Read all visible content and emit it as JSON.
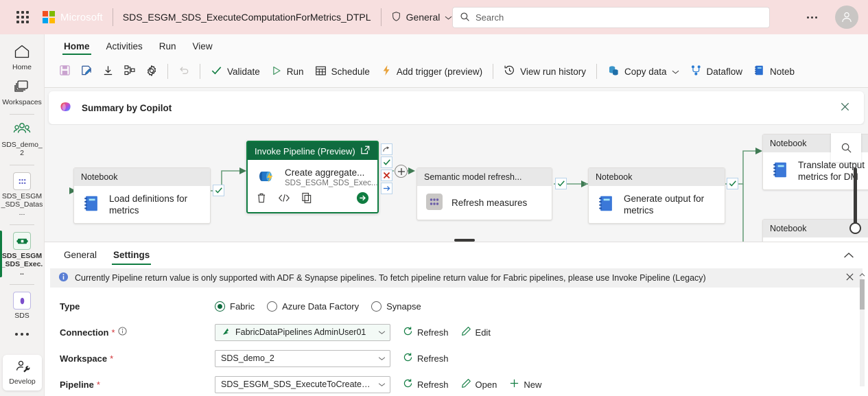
{
  "topbar": {
    "brand": "Microsoft",
    "doc_title": "SDS_ESGM_SDS_ExecuteComputationForMetrics_DTPL",
    "workspace_badge": "General",
    "search_placeholder": "Search",
    "search_value": ""
  },
  "rail": {
    "items": [
      {
        "label": "Home",
        "icon": "home-icon"
      },
      {
        "label": "Workspaces",
        "icon": "workspaces-icon"
      },
      {
        "label": "SDS_demo_2",
        "icon": "people-icon"
      },
      {
        "label": "SDS_ESGM_SDS_Datas...",
        "icon": "lakehouse-icon"
      },
      {
        "label": "SDS_ESGM_SDS_Exec...",
        "icon": "pipeline-icon"
      },
      {
        "label": "SDS",
        "icon": "semantic-model-icon"
      }
    ],
    "more": "...",
    "develop": "Develop"
  },
  "ribbon": {
    "tabs": [
      {
        "label": "Home",
        "active": true
      },
      {
        "label": "Activities",
        "active": false
      },
      {
        "label": "Run",
        "active": false
      },
      {
        "label": "View",
        "active": false
      }
    ],
    "toolbar": [
      {
        "label": "",
        "icon": "save-icon"
      },
      {
        "label": "",
        "icon": "save-as-icon"
      },
      {
        "label": "",
        "icon": "download-icon"
      },
      {
        "label": "",
        "icon": "share-icon"
      },
      {
        "label": "",
        "icon": "settings-gear-icon"
      },
      {
        "label": "",
        "icon": "undo-icon"
      },
      {
        "label": "Validate",
        "icon": "checkmark-icon"
      },
      {
        "label": "Run",
        "icon": "play-icon"
      },
      {
        "label": "Schedule",
        "icon": "calendar-icon"
      },
      {
        "label": "Add trigger (preview)",
        "icon": "lightning-icon"
      },
      {
        "label": "View run history",
        "icon": "history-icon"
      },
      {
        "label": "Copy data",
        "icon": "copy-data-icon"
      },
      {
        "label": "Dataflow",
        "icon": "dataflow-icon"
      },
      {
        "label": "Noteb",
        "icon": "notebook-icon"
      }
    ]
  },
  "copilot": {
    "title": "Summary by Copilot",
    "close": "close-icon"
  },
  "canvas": {
    "nodes": [
      {
        "type": "Notebook",
        "name": "Load definitions for metrics",
        "subtitle": "",
        "icon": "notebook-icon"
      },
      {
        "type": "Invoke Pipeline (Preview)",
        "name": "Create aggregate...",
        "subtitle": "SDS_ESGM_SDS_Exec...",
        "icon": "invoke-pipeline-icon",
        "selected": true
      },
      {
        "type": "Semantic model refresh...",
        "name": "Refresh measures",
        "subtitle": "",
        "icon": "semantic-model-icon"
      },
      {
        "type": "Notebook",
        "name": "Generate output for metrics",
        "subtitle": "",
        "icon": "notebook-icon"
      },
      {
        "type": "Notebook",
        "name": "Translate output metrics for DM",
        "subtitle": "",
        "icon": "notebook-icon"
      },
      {
        "type": "Notebook",
        "name": "",
        "subtitle": "",
        "icon": "notebook-icon"
      }
    ],
    "node_actions": {
      "delete": "trash-icon",
      "code": "code-icon",
      "clone": "copy-icon",
      "run": "run-arrow-icon"
    },
    "connectors": {
      "skip": "skip-icon",
      "success": "success-check-icon",
      "fail": "fail-x-icon",
      "completion": "completion-arrow-icon",
      "add": "+"
    },
    "search_icon": "search-icon"
  },
  "panel": {
    "tabs": [
      {
        "label": "General",
        "active": false
      },
      {
        "label": "Settings",
        "active": true
      }
    ],
    "collapse_icon": "chevron-up-icon",
    "info": {
      "icon": "info-icon",
      "text": "Currently Pipeline return value is only supported with ADF & Synapse pipelines. To fetch pipeline return value for Fabric pipelines, please use Invoke Pipeline (Legacy)",
      "close": "close-icon"
    },
    "fields": {
      "type": {
        "label": "Type",
        "options": [
          {
            "label": "Fabric",
            "selected": true
          },
          {
            "label": "Azure Data Factory",
            "selected": false
          },
          {
            "label": "Synapse",
            "selected": false
          }
        ]
      },
      "connection": {
        "label": "Connection",
        "required": "*",
        "info_icon": "info-circle-icon",
        "value": "FabricDataPipelines AdminUser01",
        "actions": [
          {
            "label": "Refresh",
            "icon": "refresh-icon"
          },
          {
            "label": "Edit",
            "icon": "pencil-icon"
          }
        ]
      },
      "workspace": {
        "label": "Workspace",
        "required": "*",
        "value": "SDS_demo_2",
        "actions": [
          {
            "label": "Refresh",
            "icon": "refresh-icon"
          }
        ]
      },
      "pipeline": {
        "label": "Pipeline",
        "required": "*",
        "value": "SDS_ESGM_SDS_ExecuteToCreateAg...",
        "actions": [
          {
            "label": "Refresh",
            "icon": "refresh-icon"
          },
          {
            "label": "Open",
            "icon": "pencil-icon"
          },
          {
            "label": "New",
            "icon": "plus-icon"
          }
        ]
      }
    }
  },
  "colors": {
    "accent_green": "#107c41",
    "topbar_bg": "#f7dfdf",
    "selected_node_header": "#0f6b3f",
    "required_red": "#d13438"
  }
}
